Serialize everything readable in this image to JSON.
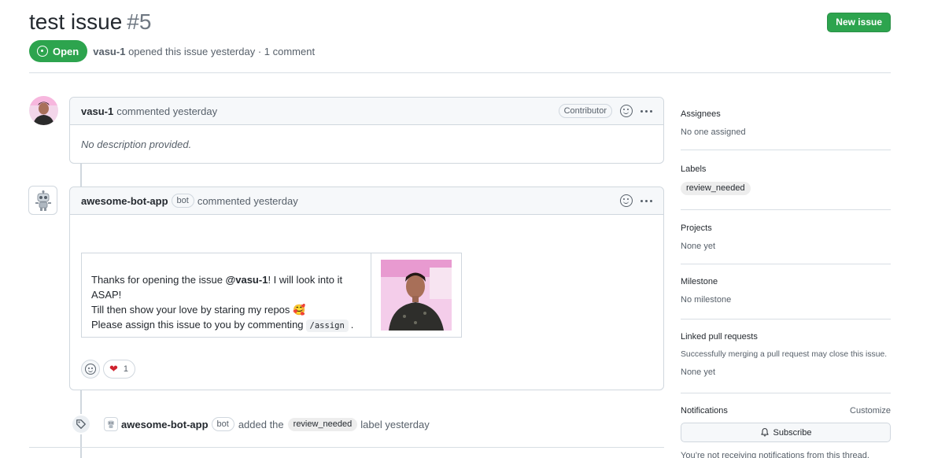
{
  "issue": {
    "title": "test issue",
    "number": "#5",
    "state": "Open",
    "author": "vasu-1",
    "opened_text": "opened this issue yesterday · 1 comment",
    "new_issue_label": "New issue"
  },
  "comments": [
    {
      "author": "vasu-1",
      "action": "commented yesterday",
      "badge": "Contributor",
      "body": "No description provided."
    },
    {
      "author": "awesome-bot-app",
      "bot_badge": "bot",
      "action": "commented yesterday",
      "body_line1_prefix": "Thanks for opening the issue ",
      "body_line1_mention": "@vasu-1",
      "body_line1_suffix": "! I will look into it ASAP!",
      "body_line2": "Till then show your love by staring my repos 🥰",
      "body_line3_prefix": "Please assign this issue to you by commenting",
      "body_line3_code": "/assign",
      "body_line3_suffix": ".",
      "reaction_heart": "❤",
      "reaction_count": "1"
    }
  ],
  "event": {
    "actor": "awesome-bot-app",
    "bot_badge": "bot",
    "text_before": "added the",
    "label": "review_needed",
    "text_after": "label yesterday"
  },
  "sidebar": {
    "assignees_title": "Assignees",
    "assignees_value": "No one assigned",
    "labels_title": "Labels",
    "labels_value": "review_needed",
    "projects_title": "Projects",
    "projects_value": "None yet",
    "milestone_title": "Milestone",
    "milestone_value": "No milestone",
    "linked_title": "Linked pull requests",
    "linked_desc": "Successfully merging a pull request may close this issue.",
    "linked_value": "None yet",
    "notifications_title": "Notifications",
    "customize_label": "Customize",
    "subscribe_label": "Subscribe",
    "notifications_note": "You’re not receiving notifications from this thread."
  },
  "colors": {
    "open_green": "#2da44e",
    "border": "#d0d7de",
    "muted_text": "#57606a"
  }
}
